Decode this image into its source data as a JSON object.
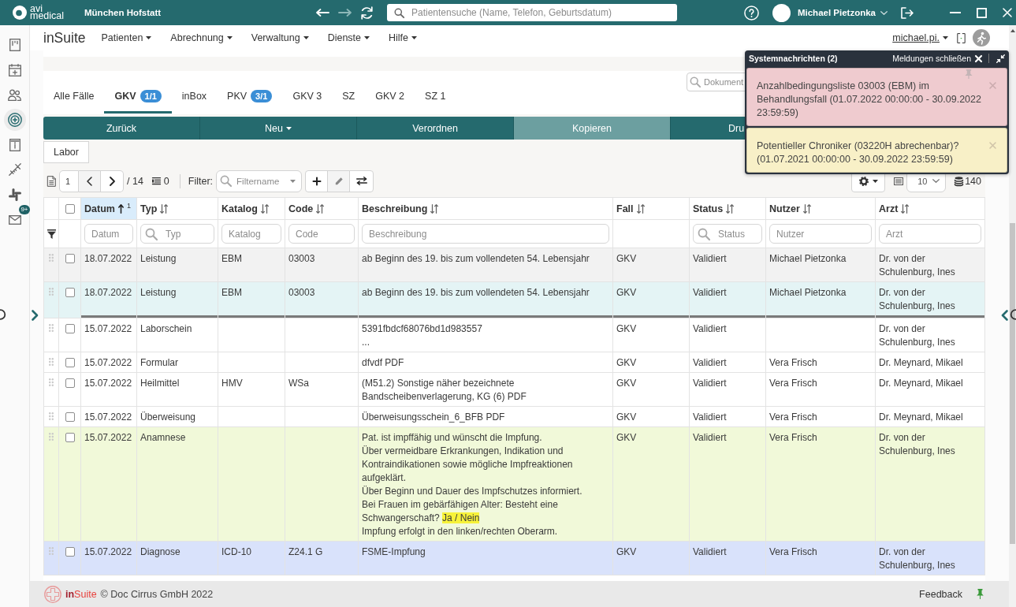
{
  "title_bar": {
    "brand": "avi\nmedical",
    "location": "München Hofstatt",
    "search": {
      "placeholder": "Patientensuche (Name, Telefon, Geburtsdatum)"
    },
    "user": "Michael Pietzonka"
  },
  "sidebar": {
    "items": [
      {
        "selected": false
      },
      {
        "selected": false
      },
      {
        "selected": false
      },
      {
        "selected": true
      },
      {
        "selected": false
      },
      {
        "selected": false
      },
      {
        "selected": false
      },
      {
        "selected": false,
        "badge": "9+"
      }
    ]
  },
  "nav": {
    "brand": "inSuite",
    "menus": [
      {
        "label": "Patienten"
      },
      {
        "label": "Abrechnung"
      },
      {
        "label": "Verwaltung"
      },
      {
        "label": "Dienste"
      },
      {
        "label": "Hilfe"
      }
    ],
    "account": "michael.pi."
  },
  "tabs": [
    {
      "label": "Alle Fälle",
      "selected": false
    },
    {
      "label": "GKV",
      "badge": "1/1",
      "selected": true
    },
    {
      "label": "inBox",
      "selected": false
    },
    {
      "label": "PKV",
      "badge": "3/1",
      "selected": false
    },
    {
      "label": "GKV 3",
      "selected": false
    },
    {
      "label": "SZ",
      "selected": false
    },
    {
      "label": "GKV 2",
      "selected": false
    },
    {
      "label": "SZ 1",
      "selected": false
    }
  ],
  "document_search": {
    "placeholder": "Dokument"
  },
  "actions": [
    {
      "label": "Zurück",
      "menu": false,
      "highlighted": false,
      "clipped": false
    },
    {
      "label": "Neu",
      "menu": true,
      "highlighted": false,
      "clipped": false
    },
    {
      "label": "Verordnen",
      "menu": false,
      "highlighted": false,
      "clipped": false
    },
    {
      "label": "Kopieren",
      "menu": false,
      "highlighted": true,
      "clipped": false
    },
    {
      "label": "Dru",
      "menu": false,
      "highlighted": false,
      "clipped": true
    }
  ],
  "category_button": {
    "label": "Labor"
  },
  "toolbar": {
    "page": "1",
    "page_count": "/ 14",
    "selected_count": "0",
    "filter_label": "Filter:",
    "filter_placeholder": "Filtername",
    "page_size": "10",
    "total": "140"
  },
  "table": {
    "select_all": {
      "checked": false
    },
    "columns": [
      {
        "label": "Datum",
        "sorted": true,
        "sort_rank": "1",
        "filter": {
          "placeholder": "Datum",
          "search_icon": false
        }
      },
      {
        "label": "Typ",
        "sorted": false,
        "filter": {
          "placeholder": "Typ",
          "search_icon": true
        }
      },
      {
        "label": "Katalog",
        "sorted": false,
        "filter": {
          "placeholder": "Katalog",
          "search_icon": false
        }
      },
      {
        "label": "Code",
        "sorted": false,
        "filter": {
          "placeholder": "Code",
          "search_icon": false
        }
      },
      {
        "label": "Beschreibung",
        "sorted": false,
        "filter": {
          "placeholder": "Beschreibung",
          "search_icon": false
        }
      },
      {
        "label": "Fall",
        "sorted": false
      },
      {
        "label": "Status",
        "sorted": false,
        "filter": {
          "placeholder": "Status",
          "search_icon": true
        }
      },
      {
        "label": "Nutzer",
        "sorted": false,
        "filter": {
          "placeholder": "Nutzer",
          "search_icon": false
        }
      },
      {
        "label": "Arzt",
        "sorted": false,
        "filter": {
          "placeholder": "Arzt",
          "search_icon": false
        }
      }
    ],
    "rows": [
      {
        "date": "18.07.2022",
        "type": "Leistung",
        "catalog": "EBM",
        "code": "03003",
        "description": "ab Beginn des 19. bis zum vollendeten 54. Lebensjahr",
        "case": "GKV",
        "status": "Validiert",
        "user": "Michael Pietzonka",
        "doctor": "Dr. von der Schulenburg, Ines",
        "checked": false,
        "color": "#f2f2f2",
        "separator_below": false
      },
      {
        "date": "18.07.2022",
        "type": "Leistung",
        "catalog": "EBM",
        "code": "03003",
        "description": "ab Beginn des 19. bis zum vollendeten 54. Lebensjahr",
        "case": "GKV",
        "status": "Validiert",
        "user": "Michael Pietzonka",
        "doctor": "Dr. von der Schulenburg, Ines",
        "checked": false,
        "color": "#e4f4f5",
        "separator_below": true
      },
      {
        "date": "15.07.2022",
        "type": "Laborschein",
        "description": "5391fbdcf68076bd1d983557\n...",
        "case": "GKV",
        "status": "Validiert",
        "doctor": "Dr. von der Schulenburg, Ines",
        "checked": false,
        "color": "#ffffff",
        "separator_below": false
      },
      {
        "date": "15.07.2022",
        "type": "Formular",
        "description": "dfvdf PDF",
        "case": "GKV",
        "status": "Validiert",
        "user": "Vera Frisch",
        "doctor": "Dr. Meynard, Mikael",
        "checked": false,
        "color": "#ffffff",
        "separator_below": false
      },
      {
        "date": "15.07.2022",
        "type": "Heilmittel",
        "catalog": "HMV",
        "code": "WSa",
        "description": "(M51.2) Sonstige näher bezeichnete Bandscheibenverlagerung, KG (6) PDF",
        "case": "GKV",
        "status": "Validiert",
        "user": "Vera Frisch",
        "doctor": "Dr. Meynard, Mikael",
        "checked": false,
        "color": "#ffffff",
        "separator_below": false
      },
      {
        "date": "15.07.2022",
        "type": "Überweisung",
        "description": "Überweisungsschein_6_BFB PDF",
        "case": "GKV",
        "status": "Validiert",
        "user": "Vera Frisch",
        "doctor": "Dr. Meynard, Mikael",
        "checked": false,
        "color": "#ffffff",
        "separator_below": false
      },
      {
        "date": "15.07.2022",
        "type": "Anamnese",
        "description": [
          {
            "text": "Pat. ist impffähig und wünscht die Impfung.\nÜber vermeidbare Erkrankungen, Indikation und Kontraindikationen sowie mögliche Impfreaktionen aufgeklärt.\nÜber Beginn und Dauer des Impfschutzes informiert.\nBei Frauen im gebärfähigen Alter: Besteht eine Schwangerschaft? ",
            "highlight": false
          },
          {
            "text": "Ja / Nein",
            "highlight": true
          },
          {
            "text": "\nImpfung erfolgt in den linken/rechten Oberarm.",
            "highlight": false
          }
        ],
        "case": "GKV",
        "status": "Validiert",
        "user": "Vera Frisch",
        "doctor": "Dr. von der Schulenburg, Ines",
        "checked": false,
        "color": "#f1f9d9",
        "separator_below": false
      },
      {
        "date": "15.07.2022",
        "type": "Diagnose",
        "catalog": "ICD-10",
        "code": "Z24.1 G",
        "description": "FSME-Impfung",
        "case": "GKV",
        "status": "Validiert",
        "user": "Vera Frisch",
        "doctor": "Dr. von der Schulenburg, Ines",
        "checked": false,
        "color": "#d9e2fb",
        "separator_below": false
      }
    ]
  },
  "notifications": {
    "title": "Systemnachrichten (2)",
    "close_all": "Meldungen schließen",
    "messages": [
      {
        "text": "Anzahlbedingungsliste 03003 (EBM) im Behandlungsfall (01.07.2022 00:00:00 - 30.09.2022 23:59:59)",
        "color": "#efcbcf",
        "pin": true
      },
      {
        "text": "Potentieller Chroniker (03220H abrechenbar)? (01.07.2021 00:00:00 - 30.09.2022 23:59:59)",
        "color": "#f8f0c7",
        "pin": false
      }
    ]
  },
  "footer": {
    "brand_prefix": "in",
    "brand_suffix": "Suite",
    "copyright": "© Doc Cirrus GmbH 2022",
    "feedback": "Feedback"
  }
}
